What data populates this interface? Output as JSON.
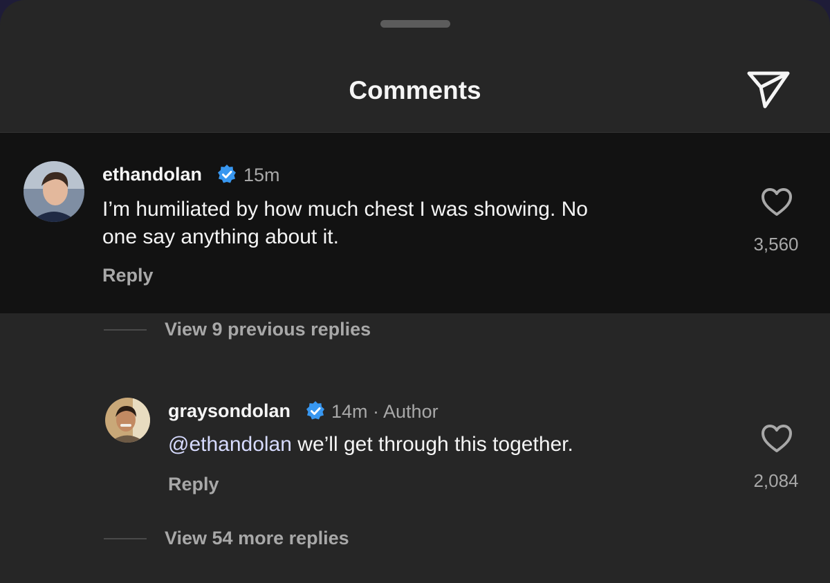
{
  "header": {
    "title": "Comments",
    "share_icon": "paper-plane-icon"
  },
  "comments": [
    {
      "username": "ethandolan",
      "verified_icon": "verified-badge-icon",
      "time": "15m",
      "text": "I’m humiliated by how much chest I was showing. No",
      "text_line2": "one say anything about it.",
      "reply_label": "Reply",
      "likes": "3,560",
      "like_icon": "heart-outline-icon"
    }
  ],
  "thread": {
    "view_previous": "View 9 previous replies",
    "view_more": "View 54 more replies",
    "reply": {
      "username": "graysondolan",
      "verified_icon": "verified-badge-icon",
      "time": "14m · Author",
      "mention": "@ethandolan",
      "text": " we’ll get through this together.",
      "reply_label": "Reply",
      "likes": "2,084",
      "like_icon": "heart-outline-icon"
    }
  },
  "colors": {
    "background": "#262626",
    "highlight": "#121212",
    "verified": "#3897f0",
    "text_primary": "#f5f5f5",
    "text_secondary": "#a8a8a8"
  }
}
